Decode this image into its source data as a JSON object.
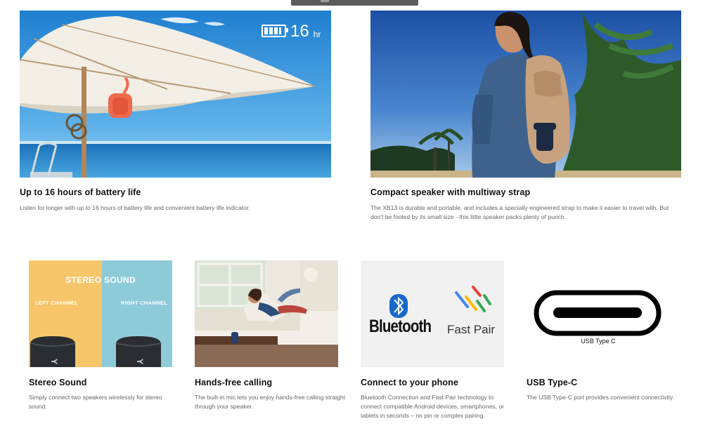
{
  "features": [
    {
      "title": "Up to 16 hours of battery life",
      "desc": "Listen for longer with up to 16 hours of battery life and convenient battery life indicator.",
      "badge_value": "16",
      "badge_unit": "hr"
    },
    {
      "title": "Compact speaker with multiway strap",
      "desc": "The XB13 is durable and portable, and includes a specially engineered strap to make it easier to travel with. But don't be fooled by its small size - this little speaker packs plenty of punch."
    }
  ],
  "tiles": [
    {
      "title": "Stereo Sound",
      "desc": "Simply connect two speakers wirelessly for stereo sound.",
      "image_heading": "STEREO SOUND",
      "left_label": "LEFT CHANNEL",
      "right_label": "RIGHT CHANNEL"
    },
    {
      "title": "Hands-free calling",
      "desc": "The built-in mic lets you enjoy hands-free calling straight through your speaker."
    },
    {
      "title": "Connect to your phone",
      "desc": "Bluetooth Connection and Fast Pair technology to connect compatible Android devices, smartphones, or tablets in seconds – no pin or complex pairing.",
      "logo_bluetooth": "Bluetooth",
      "logo_fastpair": "Fast Pair"
    },
    {
      "title": "USB Type-C",
      "desc": "The USB Type-C port provides convenient connectivity.",
      "image_label": "USB Type C"
    }
  ],
  "colors": {
    "stereo_left": "#f7c66a",
    "stereo_right": "#8ecbd9",
    "sky": "#2f8fd7",
    "speaker_orange": "#f06a4a"
  }
}
